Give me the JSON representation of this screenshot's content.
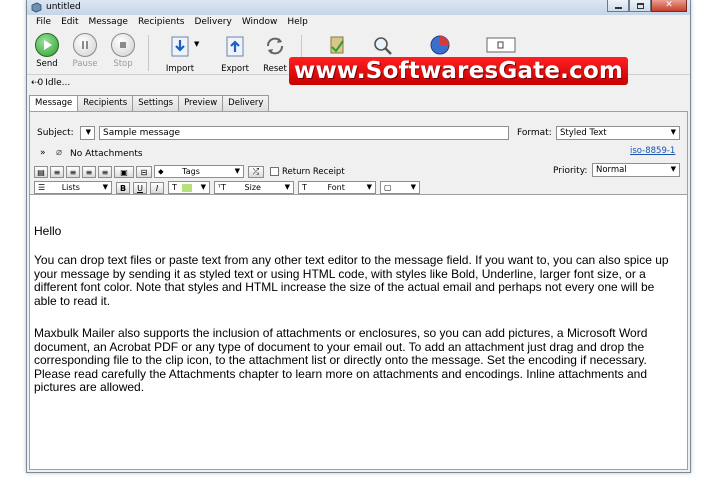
{
  "window": {
    "title": "untitled"
  },
  "menu": [
    "File",
    "Edit",
    "Message",
    "Recipients",
    "Delivery",
    "Window",
    "Help"
  ],
  "toolbar": {
    "send": "Send",
    "pause": "Pause",
    "stop": "Stop",
    "import": "Import",
    "export": "Export",
    "reset": "Reset"
  },
  "watermark": "www.SoftwaresGate.com",
  "status": "Idle...",
  "tabs": [
    "Message",
    "Recipients",
    "Settings",
    "Preview",
    "Delivery"
  ],
  "message": {
    "subject_label": "Subject:",
    "subject_value": "Sample message",
    "format_label": "Format:",
    "format_value": "Styled Text",
    "encoding_link": "iso-8859-1",
    "attachments": "No Attachments",
    "priority_label": "Priority:",
    "priority_value": "Normal",
    "tags_label": "Tags",
    "return_receipt": "Return Receipt",
    "lists_label": "Lists",
    "bold": "B",
    "underline": "U",
    "italic": "I",
    "size_label": "Size",
    "font_label": "Font"
  },
  "body": {
    "greeting": "Hello",
    "para1": "You can drop text files or paste text from any other text editor to the message field. If you want to, you can also spice up your message by sending it as styled text or using HTML code, with styles like Bold, Underline, larger font size, or a different font color. Note that styles and HTML increase the size of the actual email and perhaps not every one will be able to read it.",
    "para2": "Maxbulk Mailer also supports the inclusion of attachments or enclosures, so you can add pictures, a Microsoft Word document, an Acrobat PDF or any type of document to your email out. To add an attachment just drag and drop the corresponding file to the clip icon, to the attachment list or directly onto the message. Set the encoding if necessary. Please read carefully the Attachments chapter to learn more on attachments and encodings. Inline attachments and pictures are allowed."
  },
  "colors": {
    "send_green": "#2e9d2e",
    "watermark_red": "#d60000",
    "link_blue": "#1a54b0"
  }
}
